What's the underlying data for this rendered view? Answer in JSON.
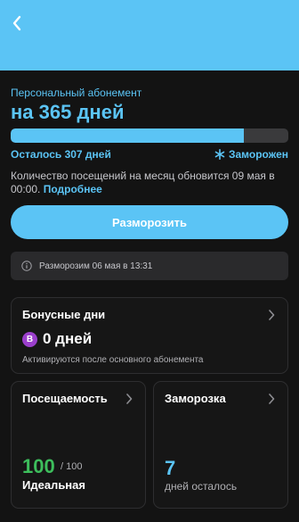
{
  "header": {
    "back_icon": "chevron-left-icon",
    "color": "#5BC4F5"
  },
  "subscription": {
    "label": "Персональный абонемент",
    "title": "на 365 дней",
    "progress_fraction": 0.84,
    "remaining": "Осталось 307 дней",
    "status_icon": "snowflake-icon",
    "status": "Заморожен",
    "visits_note": "Количество посещений на месяц обновится 09 мая в 00:00.",
    "more_link": "Подробнее"
  },
  "unfreeze_button": "Разморозить",
  "info": {
    "icon": "info-icon",
    "text": "Разморозим 06 мая в 13:31"
  },
  "bonus_card": {
    "title": "Бонусные дни",
    "badge": "B",
    "value": "0 дней",
    "note": "Активируются после основного абонемента"
  },
  "attendance_card": {
    "title": "Посещаемость",
    "score": "100",
    "max": "/ 100",
    "label": "Идеальная",
    "score_color": "#3DBE5C"
  },
  "freeze_card": {
    "title": "Заморозка",
    "value": "7",
    "label": "дней осталось"
  }
}
